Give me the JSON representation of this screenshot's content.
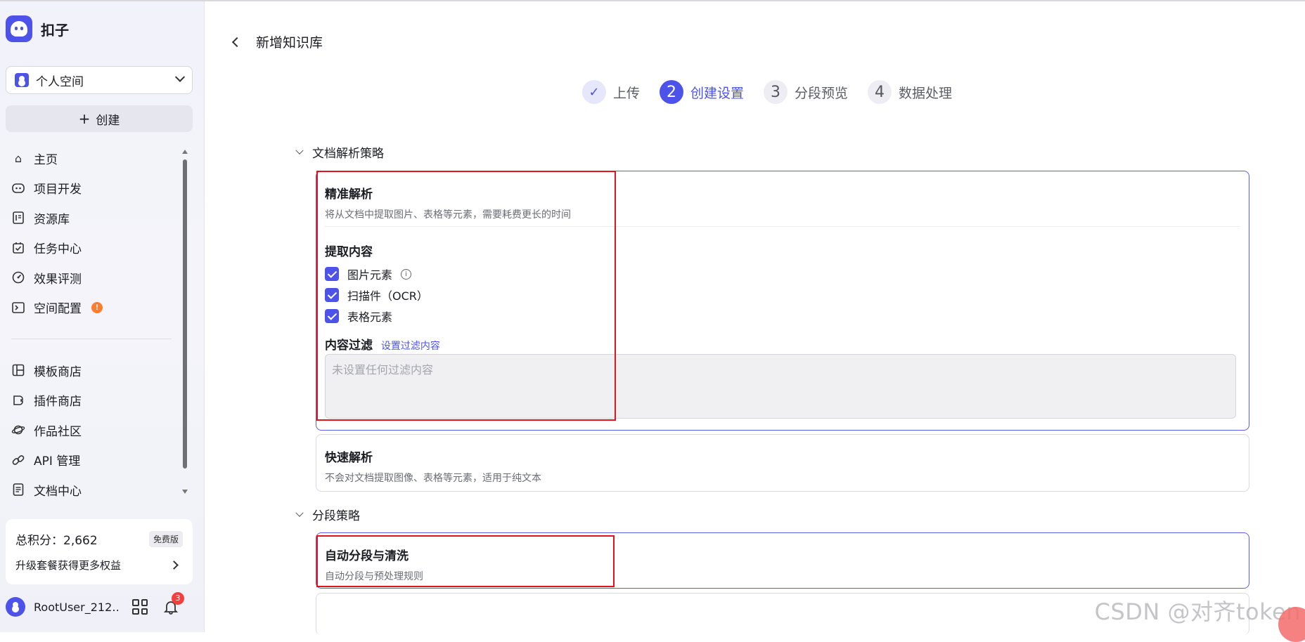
{
  "app": {
    "name": "扣子"
  },
  "space": {
    "label": "个人空间"
  },
  "sidebar": {
    "create_label": "创建",
    "items": [
      {
        "label": "主页",
        "icon": "home-icon"
      },
      {
        "label": "项目开发",
        "icon": "bot-icon"
      },
      {
        "label": "资源库",
        "icon": "library-icon"
      },
      {
        "label": "任务中心",
        "icon": "task-icon"
      },
      {
        "label": "效果评测",
        "icon": "gauge-icon"
      },
      {
        "label": "空间配置",
        "icon": "terminal-icon",
        "badge": "!"
      }
    ],
    "items2": [
      {
        "label": "模板商店",
        "icon": "template-icon"
      },
      {
        "label": "插件商店",
        "icon": "plugin-icon"
      },
      {
        "label": "作品社区",
        "icon": "planet-icon"
      },
      {
        "label": "API 管理",
        "icon": "link-icon"
      },
      {
        "label": "文档中心",
        "icon": "doc-icon"
      }
    ],
    "points_label": "总积分：2,662",
    "free_badge": "免费版",
    "upgrade_label": "升级套餐获得更多权益",
    "user_name": "RootUser_212…",
    "notification_count": "3"
  },
  "page": {
    "title": "新增知识库",
    "steps": [
      {
        "num": "✓",
        "label": "上传",
        "state": "done"
      },
      {
        "num": "2",
        "label": "创建设置",
        "state": "active"
      },
      {
        "num": "3",
        "label": "分段预览",
        "state": "todo"
      },
      {
        "num": "4",
        "label": "数据处理",
        "state": "todo"
      }
    ],
    "parse_section": "文档解析策略",
    "precise": {
      "title": "精准解析",
      "desc": "将从文档中提取图片、表格等元素，需要耗费更长的时间",
      "extract_title": "提取内容",
      "options": [
        "图片元素",
        "扫描件（OCR）",
        "表格元素"
      ],
      "filter_title": "内容过滤",
      "filter_link": "设置过滤内容",
      "filter_placeholder": "未设置任何过滤内容"
    },
    "fast": {
      "title": "快速解析",
      "desc": "不会对文档提取图像、表格等元素，适用于纯文本"
    },
    "segment_section": "分段策略",
    "auto_segment": {
      "title": "自动分段与清洗",
      "desc": "自动分段与预处理规则"
    }
  },
  "watermark": "CSDN @对齐token",
  "colors": {
    "accent": "#4d53e8",
    "highlight": "#e0141e",
    "warning": "#ff7d2c",
    "badge": "#f53f3f"
  }
}
